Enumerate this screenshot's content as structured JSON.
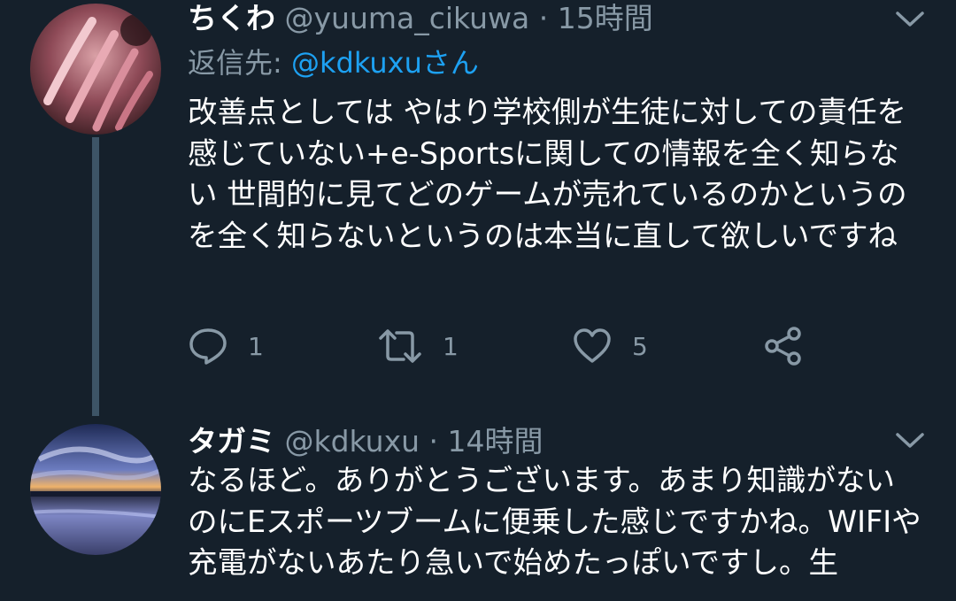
{
  "tweets": [
    {
      "display_name": "ちくわ",
      "handle": "@yuuma_cikuwa",
      "separator": "·",
      "time": "15時間",
      "reply_prefix": "返信先: ",
      "reply_mention": "@kdkuxuさん",
      "body": "改善点としては やはり学校側が生徒に対しての責任を感じていない+e-Sportsに関しての情報を全く知らない 世間的に見てどのゲームが売れているのかというのを全く知らないというのは本当に直して欲しいですね",
      "reply_count": "1",
      "retweet_count": "1",
      "like_count": "5",
      "avatar_icon": "avatar-photo-pink-nails"
    },
    {
      "display_name": "タガミ",
      "handle": "@kdkuxu",
      "separator": "·",
      "time": "14時間",
      "body": "なるほど。ありがとうございます。あまり知識がないのにEスポーツブームに便乗した感じですかね。WIFIや充電がないあたり急いで始めたっぽいですし。生",
      "avatar_icon": "avatar-photo-sunset-lake"
    }
  ],
  "icons": {
    "reply": "reply-bubble-icon",
    "retweet": "retweet-icon",
    "like": "heart-icon",
    "share": "share-icon",
    "menu": "chevron-down-icon"
  },
  "colors": {
    "background": "#15202b",
    "text": "#ffffff",
    "secondary": "#8899a6",
    "link": "#1da1f2",
    "thread_line": "#3d5466"
  }
}
